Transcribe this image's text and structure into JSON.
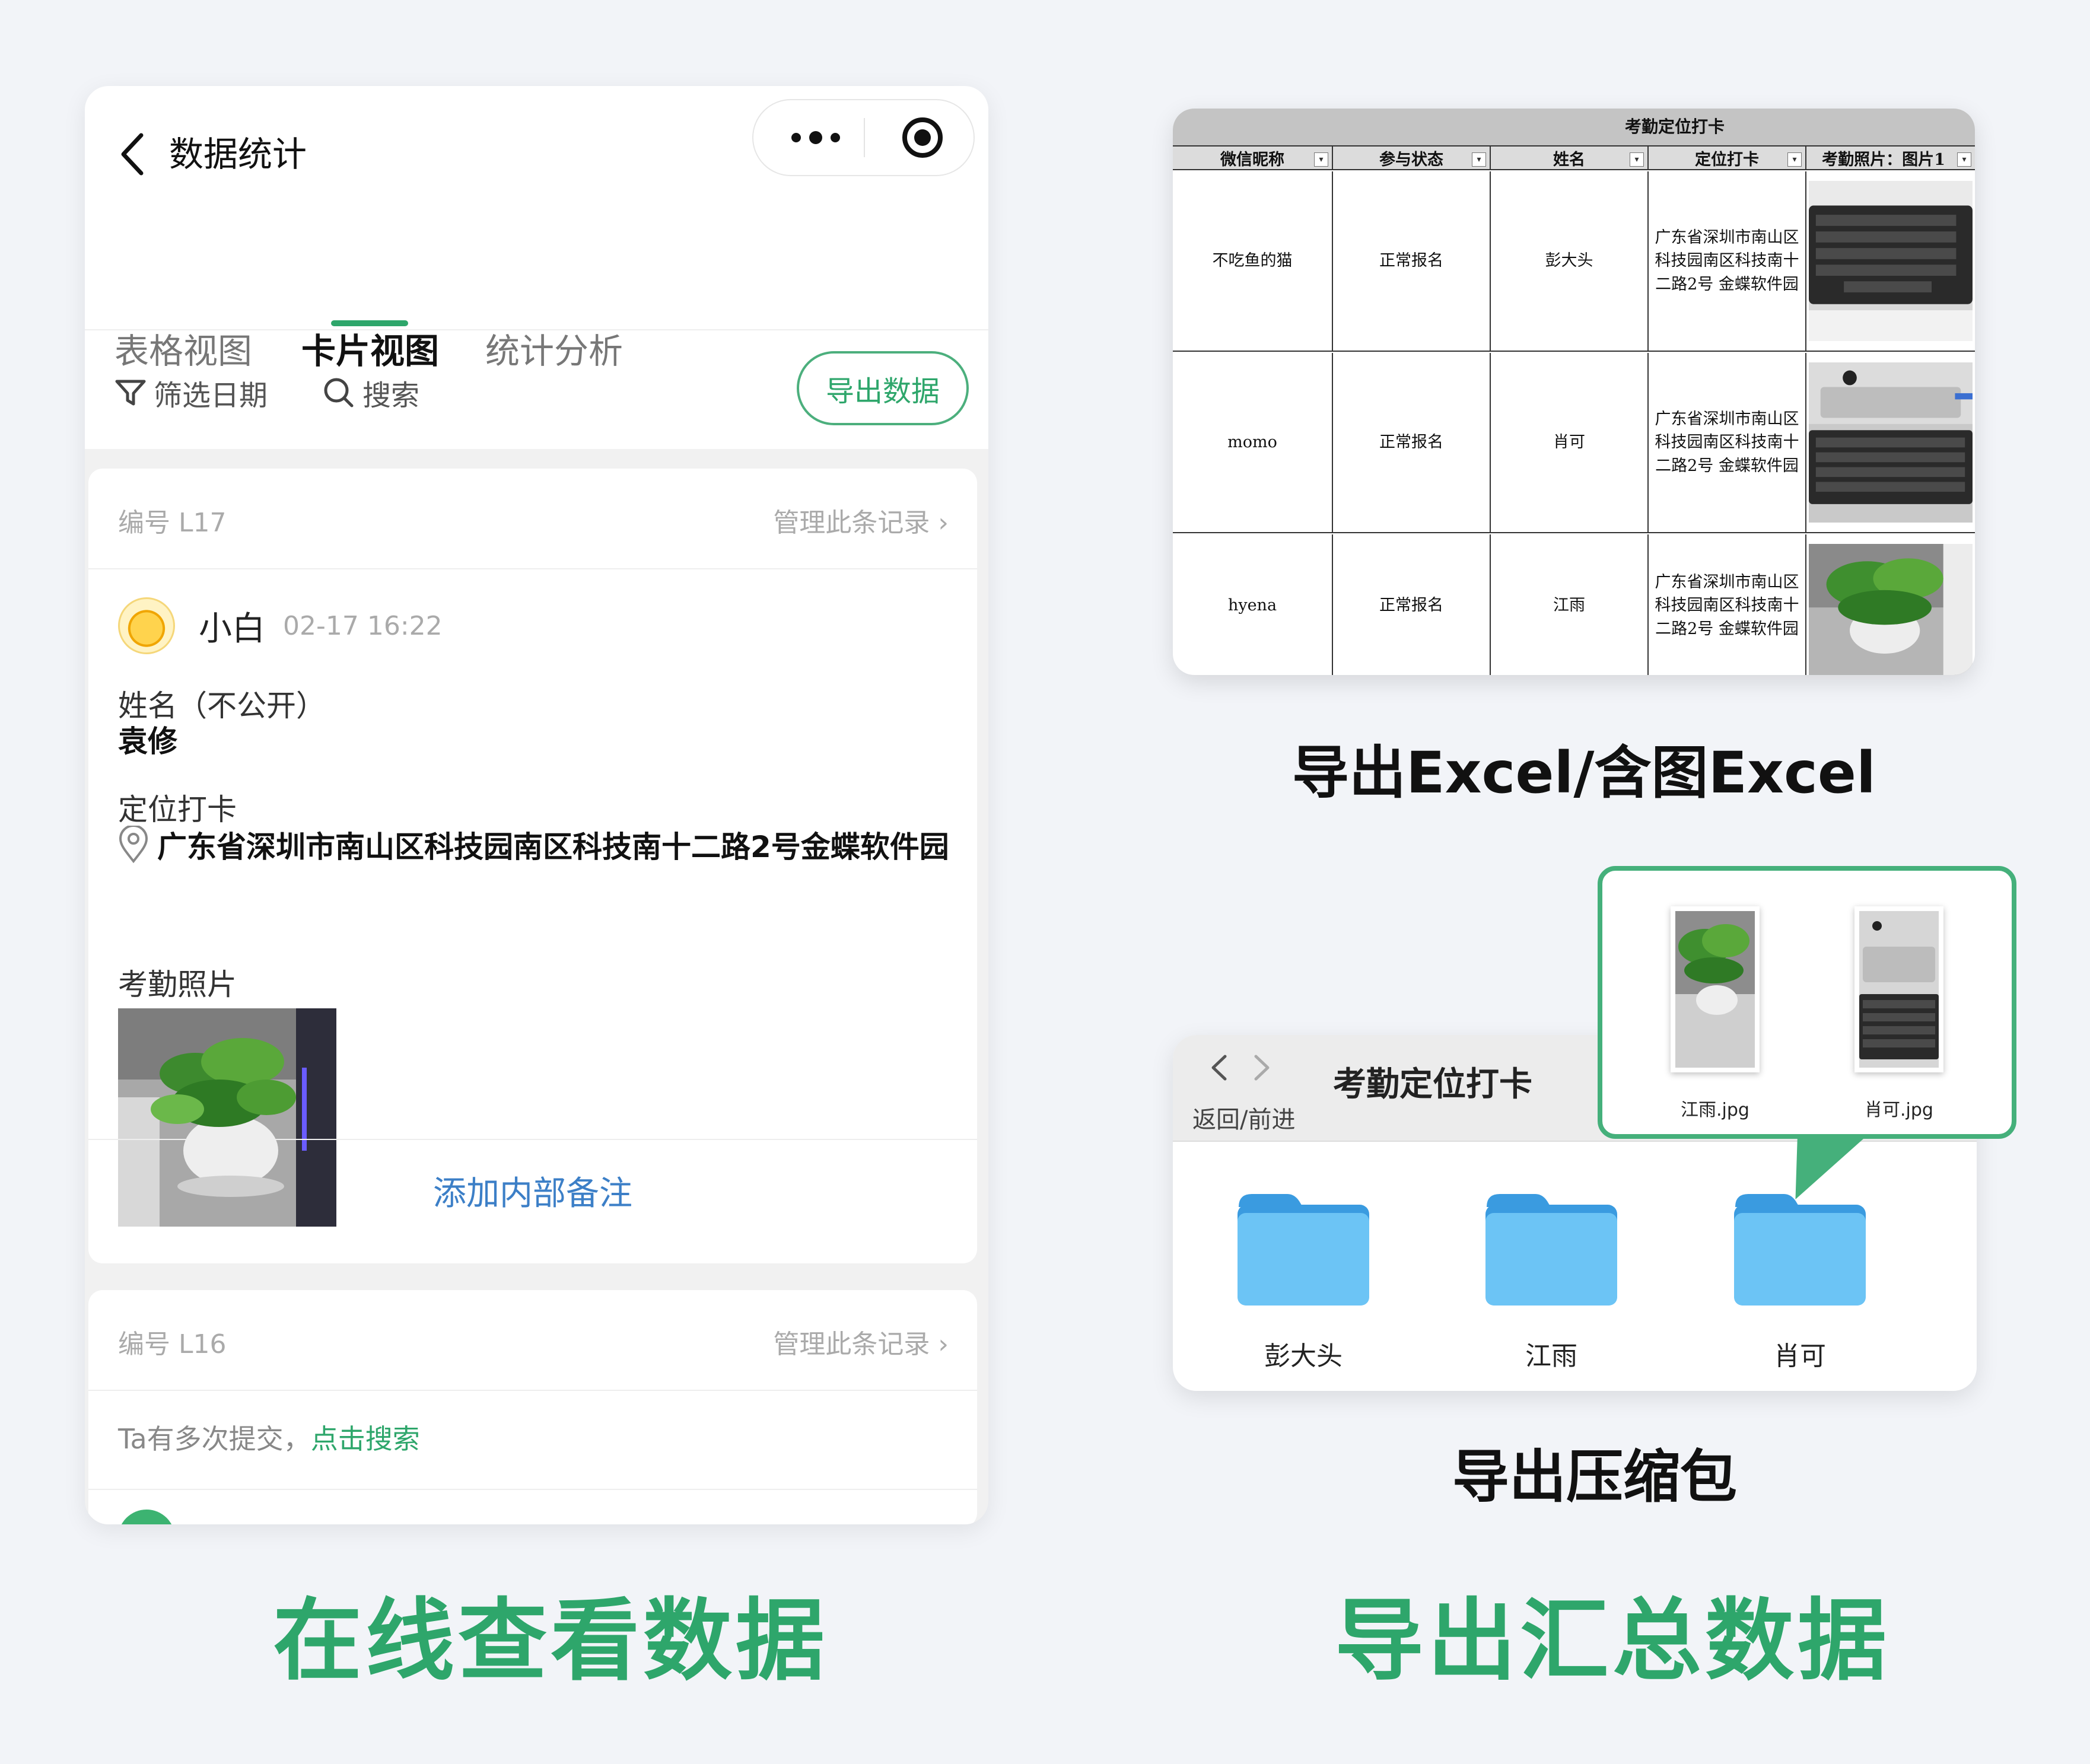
{
  "phone": {
    "nav_title": "数据统计",
    "tabs": [
      "表格视图",
      "卡片视图",
      "统计分析"
    ],
    "active_tab": "卡片视图",
    "toolbar": {
      "filter_label": "筛选日期",
      "search_label": "搜索",
      "export_label": "导出数据"
    },
    "card1": {
      "record_no": "编号 L17",
      "manage": "管理此条记录 ›",
      "user_name": "小白",
      "time": "02-17 16:22",
      "name_label": "姓名（不公开）",
      "name_value": "袁修",
      "location_label": "定位打卡",
      "location_value": "广东省深圳市南山区科技园南区科技南十二路2号金蝶软件园",
      "photo_label": "考勤照片",
      "add_note": "添加内部备注"
    },
    "card2": {
      "record_no": "编号 L16",
      "manage": "管理此条记录 ›",
      "multi_prefix": "Ta有多次提交，",
      "multi_link": "点击搜索"
    }
  },
  "captions": {
    "left": "在线查看数据",
    "right": "导出汇总数据",
    "excel": "导出Excel/含图Excel",
    "zip": "导出压缩包"
  },
  "excel": {
    "title": "考勤定位打卡",
    "headers": [
      "微信昵称",
      "参与状态",
      "姓名",
      "定位打卡",
      "考勤照片：图片1"
    ],
    "rows": [
      {
        "nick": "不吃鱼的猫",
        "status": "正常报名",
        "name": "彭大头",
        "location": "广东省深圳市南山区科技园南区科技南十二路2号 金蝶软件园",
        "photo": "keyboard"
      },
      {
        "nick": "momo",
        "status": "正常报名",
        "name": "肖可",
        "location": "广东省深圳市南山区科技园南区科技南十二路2号 金蝶软件园",
        "photo": "mac-keyboard"
      },
      {
        "nick": "hyena",
        "status": "正常报名",
        "name": "江雨",
        "location": "广东省深圳市南山区科技园南区科技南十二路2号 金蝶软件园",
        "photo": "plant"
      }
    ]
  },
  "finder": {
    "title": "考勤定位打卡",
    "nav_label": "返回/前进",
    "folders": [
      "彭大头",
      "江雨",
      "肖可"
    ],
    "files": [
      "江雨.jpg",
      "肖可.jpg"
    ]
  },
  "colors": {
    "accent_green": "#2ea66b",
    "link_blue": "#3c7fc7",
    "folder_blue": "#5ab8f0"
  }
}
